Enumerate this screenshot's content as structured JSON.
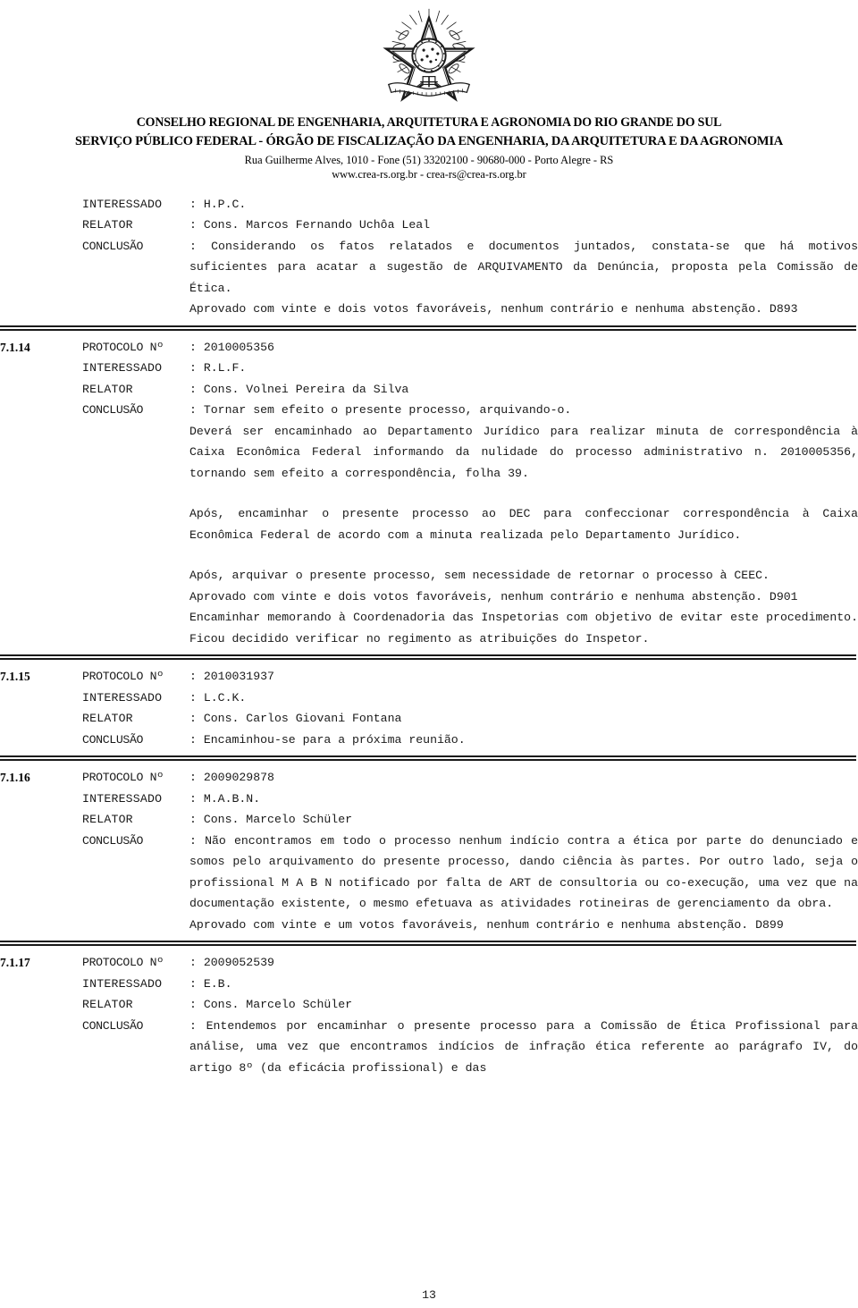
{
  "header": {
    "crest_icon": "brazil-coat-of-arms-icon",
    "org_line_1": "CONSELHO REGIONAL DE ENGENHARIA, ARQUITETURA E AGRONOMIA DO RIO GRANDE DO SUL",
    "org_line_2": "SERVIÇO PÚBLICO FEDERAL - ÓRGÃO DE FISCALIZAÇÃO DA ENGENHARIA, DA ARQUITETURA E DA AGRONOMIA",
    "address": "Rua Guilherme Alves, 1010 - Fone (51) 33202100 - 90680-000 - Porto Alegre - RS",
    "web": "www.crea-rs.org.br - crea-rs@crea-rs.org.br"
  },
  "labels": {
    "protocolo": "PROTOCOLO Nº",
    "interessado": "INTERESSADO",
    "relator": "RELATOR",
    "conclusao": "CONCLUSÃO",
    "colon": ":"
  },
  "item_top": {
    "interessado": ": H.P.C.",
    "relator": ": Cons. Marcos Fernando Uchôa Leal",
    "conclusao_lead": ": Considerando  os  fatos  relatados  e  documentos juntados, constata-se que há motivos  suficientes  para  acatar  a  sugestão  de  ARQUIVAMENTO da Denúncia, proposta pela Comissão de Ética.",
    "para_2": "Aprovado  com  vinte  e  dois  votos  favoráveis,  nenhum  contrário e nenhuma abstenção. D893"
  },
  "items": [
    {
      "number": "7.1.14",
      "protocolo": ": 2010005356",
      "interessado": ": R.L.F.",
      "relator": ": Cons. Volnei Pereira da Silva",
      "conclusao_lead": ": Tornar sem efeito o presente processo, arquivando-o.",
      "paragraphs": [
        "Deverá  ser  encaminhado  ao  Departamento  Jurídico  para  realizar minuta de correspondência  à  Caixa Econômica Federal informando da nulidade do processo administrativo n. 2010005356, tornando sem efeito a correspondência, folha 39.",
        "Após,  encaminhar o presente processo ao DEC para confeccionar correspondência à  Caixa Econômica Federal  de acordo com a minuta realizada pelo Departamento Jurídico.",
        "Após,  arquivar  o presente processo, sem necessidade de retornar o processo à CEEC.",
        "Aprovado  com  vinte  e  dois  votos  favoráveis,  nenhum  contrário e nenhuma abstenção. D901",
        "Encaminhar  memorando  à Coordenadoria das Inspetorias  com objetivo de evitar este  procedimento.  Ficou  decidido  verificar no regimento as atribuições do Inspetor."
      ]
    },
    {
      "number": "7.1.15",
      "protocolo": ": 2010031937",
      "interessado": ": L.C.K.",
      "relator": ": Cons. Carlos Giovani Fontana",
      "conclusao_lead": ": Encaminhou-se para a próxima reunião.",
      "paragraphs": []
    },
    {
      "number": "7.1.16",
      "protocolo": ": 2009029878",
      "interessado": ": M.A.B.N.",
      "relator": ": Cons. Marcelo Schüler",
      "conclusao_lead": ": Não  encontramos em todo o processo nenhum indício contra a ética por parte do denunciado  e  somos  pelo arquivamento do presente processo, dando ciência às partes.  Por  outro  lado, seja o profissional M A B N notificado por falta de ART  de  consultoria  ou co-execução, uma vez que na documentação existente, o mesmo efetuava as atividades rotineiras de gerenciamento da obra.",
      "paragraphs": [
        "Aprovado  com  vinte  e  um  votos  favoráveis,  nenhum  contrário  e  nenhuma abstenção. D899"
      ]
    },
    {
      "number": "7.1.17",
      "protocolo": ": 2009052539",
      "interessado": ": E.B.",
      "relator": ": Cons. Marcelo Schüler",
      "conclusao_lead": ": Entendemos  por  encaminhar  o  presente  processo  para  a  Comissão de Ética Profissional  para análise, uma vez que encontramos indícios de infração ética referente  ao  parágrafo  IV,  do  artigo  8º (da eficácia profissional) e das",
      "paragraphs": []
    }
  ],
  "footer": {
    "page_number": "13"
  }
}
